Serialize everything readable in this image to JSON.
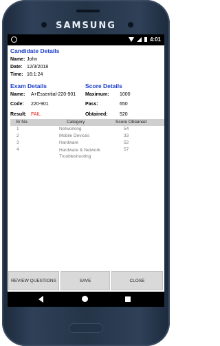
{
  "device": {
    "brand": "SAMSUNG"
  },
  "status": {
    "time": "4:01"
  },
  "candidate": {
    "heading": "Candidate Details",
    "name_label": "Name:",
    "name": "John",
    "date_label": "Date:",
    "date": "12/3/2018",
    "time_label": "Time:",
    "time": "16:1:24"
  },
  "exam": {
    "heading": "Exam Details",
    "name_label": "Name:",
    "name": "A+Essential-220-901",
    "code_label": "Code:",
    "code": "220-901",
    "result_label": "Result:",
    "result": "FAIL"
  },
  "score": {
    "heading": "Score Details",
    "maximum_label": "Maximum:",
    "maximum": "1000",
    "pass_label": "Pass:",
    "pass": "650",
    "obtained_label": "Obtained:",
    "obtained": "520"
  },
  "table": {
    "headers": [
      "Sr No.",
      "Category",
      "Score Obtained"
    ],
    "rows": [
      [
        "1",
        "Networking",
        "54"
      ],
      [
        "2",
        "Mobile Devices",
        "33"
      ],
      [
        "3",
        "Hardware",
        "52"
      ],
      [
        "4",
        "Hardware & Network Troubleshooting",
        "57"
      ]
    ]
  },
  "buttons": {
    "review": "REVIEW QUESTIONS",
    "save": "SAVE",
    "close": "CLOSE"
  }
}
